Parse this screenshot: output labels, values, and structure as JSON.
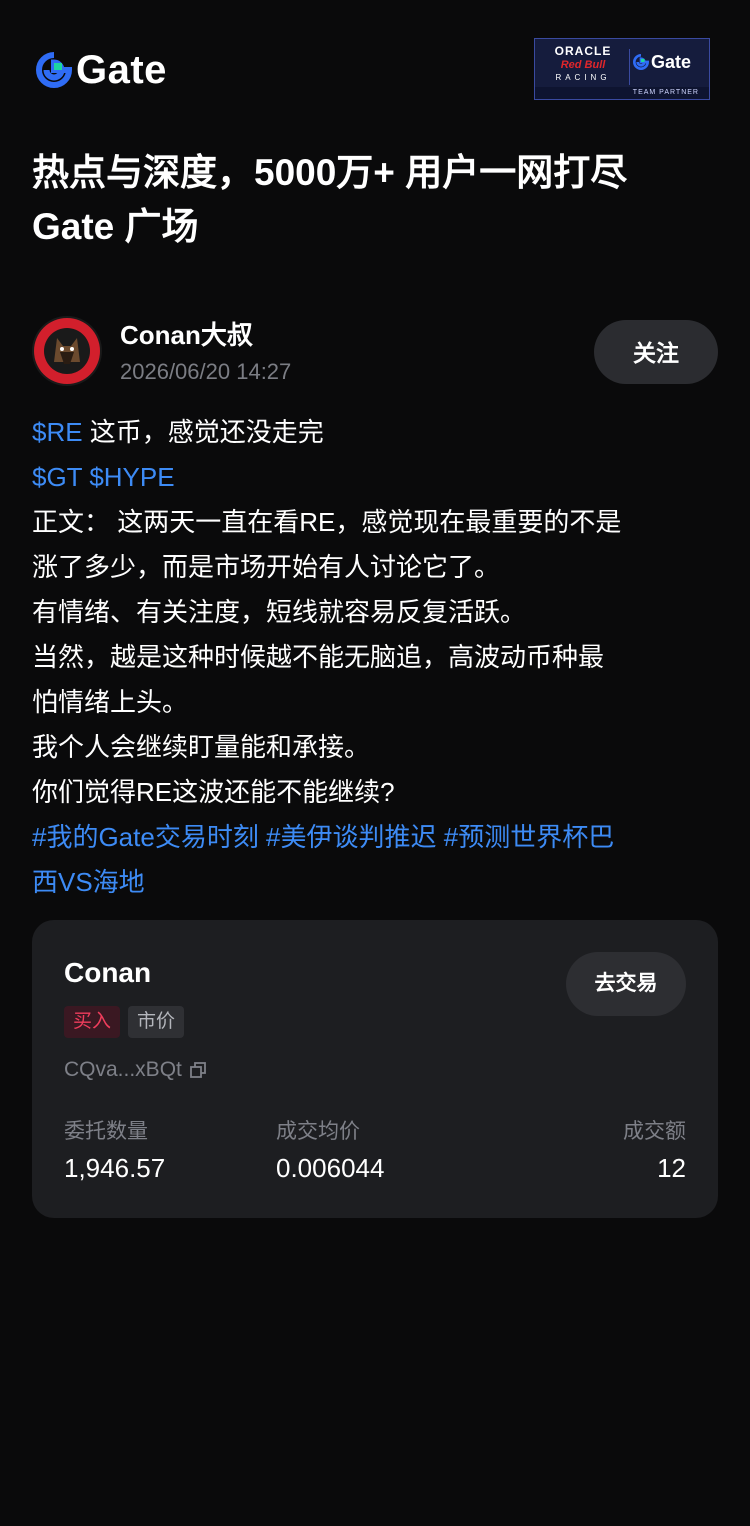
{
  "header": {
    "logo_text": "Gate",
    "partner": {
      "oracle": "ORACLE",
      "redbull": "Red Bull",
      "racing": "RACING",
      "gate": "Gate",
      "team_partner": "TEAM PARTNER"
    }
  },
  "headline": {
    "line1": "热点与深度，5000万+ 用户一网打尽",
    "line2": "Gate 广场"
  },
  "post": {
    "author": "Conan大叔",
    "avatar_text": "AMERICAN HEROS CONAN",
    "time": "2026/06/20 14:27",
    "follow_label": "关注",
    "lines": {
      "l1_tag": "$RE",
      "l1_text": " 这币，感觉还没走完",
      "l2_tag": " $GT $HYPE",
      "l3": "正文： 这两天一直在看RE，感觉现在最重要的不是",
      "l4": "涨了多少，而是市场开始有人讨论它了。",
      "l5": "有情绪、有关注度，短线就容易反复活跃。",
      "l6": "当然，越是这种时候越不能无脑追，高波动币种最",
      "l7": "怕情绪上头。",
      "l8": "我个人会继续盯量能和承接。",
      "l9": "你们觉得RE这波还能不能继续?",
      "l10_tags": "#我的Gate交易时刻 #美伊谈判推迟 #预测世界杯巴",
      "l11_tags": "西VS海地"
    }
  },
  "trade_card": {
    "name": "Conan",
    "trade_button": "去交易",
    "side_badge": "买入",
    "type_badge": "市价",
    "address": "CQva...xBQt",
    "stats": [
      {
        "label": "委托数量",
        "value": "1,946.57"
      },
      {
        "label": "成交均价",
        "value": "0.006044"
      },
      {
        "label": "成交额",
        "value": "12"
      }
    ]
  },
  "colors": {
    "background": "#0a0a0b",
    "accent_blue": "#3d8bf5",
    "logo_green": "#1dd6a0",
    "buy_red": "#f03d5c",
    "card_bg": "#1d1e21"
  }
}
